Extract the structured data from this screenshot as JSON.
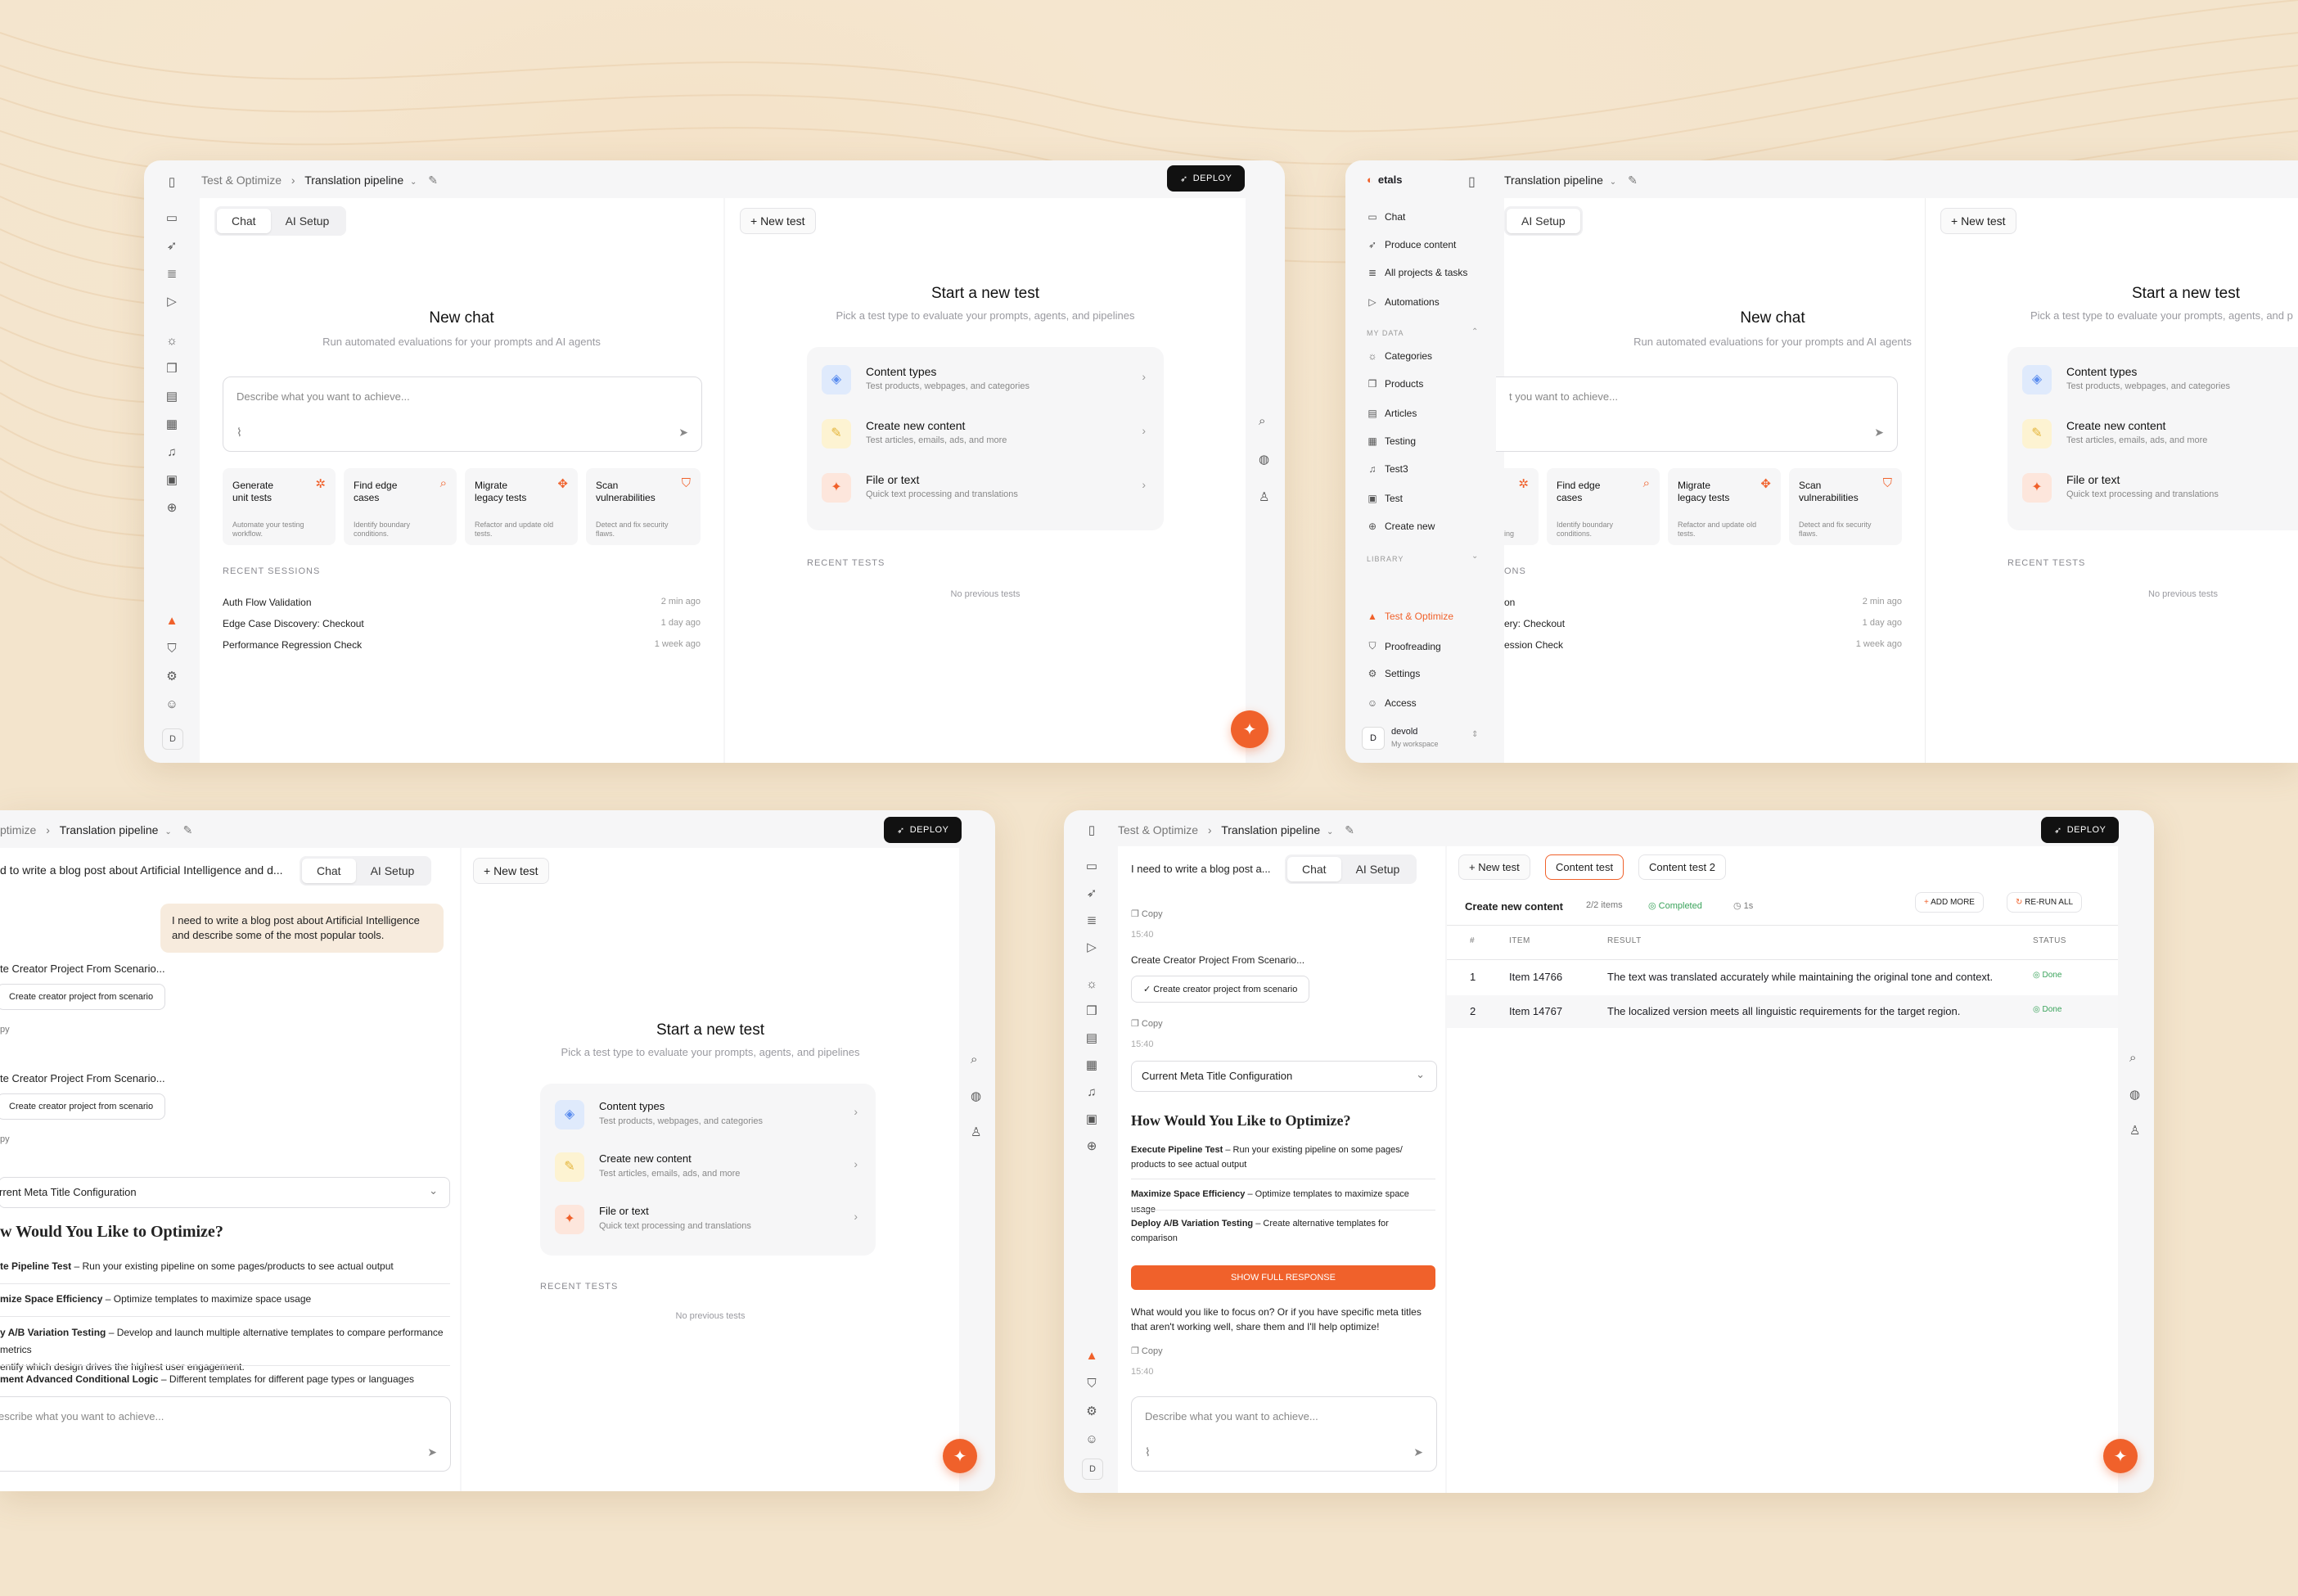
{
  "breadcrumb": {
    "section": "Test & Optimize",
    "page": "Translation pipeline"
  },
  "deploy_label": "DEPLOY",
  "tabs": {
    "chat": "Chat",
    "ai_setup": "AI Setup"
  },
  "new_test_btn": "+ New test",
  "chat": {
    "title": "New chat",
    "subtitle": "Run automated evaluations for your prompts and AI agents",
    "placeholder": "Describe what you want to achieve...",
    "placeholder_cropped": "t you want to achieve...",
    "tiles": [
      {
        "title": "Generate unit tests",
        "desc": "Automate your testing workflow."
      },
      {
        "title": "Find edge cases",
        "desc": "Identify boundary conditions."
      },
      {
        "title": "Migrate legacy tests",
        "desc": "Refactor and update old tests."
      },
      {
        "title": "Scan vulnerabilities",
        "desc": "Detect and fix security flaws."
      }
    ],
    "recent_label": "RECENT SESSIONS",
    "recent_label_cropped": "ONS",
    "sessions": [
      {
        "name": "Auth Flow Validation",
        "time": "2 min ago"
      },
      {
        "name": "Edge Case Discovery: Checkout",
        "time": "1 day ago"
      },
      {
        "name": "Performance Regression Check",
        "time": "1 week ago"
      }
    ],
    "sessions_cropped": [
      "on",
      "ery: Checkout",
      "ession Check"
    ],
    "tile_cropped_1": "ing"
  },
  "tests": {
    "title": "Start a new test",
    "subtitle": "Pick a test type to evaluate your prompts, agents, and pipelines",
    "subtitle_cropped": "Pick a test type to evaluate your prompts, agents, and p",
    "types": [
      {
        "title": "Content types",
        "desc": "Test products, webpages, and categories"
      },
      {
        "title": "Create new content",
        "desc": "Test articles, emails, ads, and more"
      },
      {
        "title": "File or text",
        "desc": "Quick text processing and translations"
      }
    ],
    "recent_label": "RECENT TESTS",
    "empty": "No previous tests"
  },
  "sidebar": {
    "brand": "etals",
    "items_top": [
      "Chat",
      "Produce content",
      "All projects & tasks",
      "Automations"
    ],
    "my_data_label": "MY DATA",
    "my_data": [
      "Categories",
      "Products",
      "Articles",
      "Testing",
      "Test3",
      "Test",
      "Create new"
    ],
    "library_label": "LIBRARY",
    "items_bottom": [
      "Test & Optimize",
      "Proofreading",
      "Settings",
      "Access"
    ],
    "user_initial": "D",
    "user_name": "devold",
    "user_workspace": "My workspace"
  },
  "rail_avatar": "D",
  "conversation": {
    "title": "d to write a blog post about Artificial Intelligence and d...",
    "title_w4": "I need to write a blog post a...",
    "user_msg": "I need to write a blog post about Artificial Intelligence and describe some of the most popular tools.",
    "step_title": "te Creator Project From Scenario...",
    "step_title_full": "Create Creator Project From Scenario...",
    "step_chip": "Create creator project from scenario",
    "copy": "Copy",
    "copy_cropped": "py",
    "timestamp": "15:40",
    "select": "rrent Meta Title Configuration",
    "select_full": "Current Meta Title Configuration",
    "heading": "w Would You Like to Optimize?",
    "heading_full": "How Would You Like to Optimize?",
    "options": [
      {
        "bold": "te Pipeline Test",
        "rest": " – Run your existing pipeline on some pages/products to see actual output"
      },
      {
        "bold": "mize Space Efficiency",
        "rest": " – Optimize templates to maximize space usage"
      },
      {
        "bold": "y A/B Variation Testing",
        "rest": " – Develop and launch multiple alternative templates to compare performance metrics"
      },
      {
        "bold": "ment Advanced Conditional Logic",
        "rest": " – Different templates for different page types or languages"
      }
    ],
    "option3_line2": "entify which design drives the highest user engagement.",
    "options_full": [
      {
        "bold": "Execute Pipeline Test",
        "rest": " – Run your existing pipeline on some pages/ products to see actual output"
      },
      {
        "bold": "Maximize Space Efficiency",
        "rest": " – Optimize templates to maximize space usage"
      },
      {
        "bold": "Deploy A/B Variation Testing",
        "rest": " – Create alternative templates for comparison"
      }
    ],
    "show_full": "SHOW FULL RESPONSE",
    "followup": "What would you like to focus on? Or if you have specific meta titles that aren't working well, share them and I'll help optimize!",
    "input_placeholder": "escribe what you want to achieve..."
  },
  "results": {
    "tabs": [
      "+ New test",
      "Content test",
      "Content test 2"
    ],
    "title": "Create new content",
    "count": "2/2 items",
    "status": "Completed",
    "duration": "1s",
    "add_more": "ADD MORE",
    "rerun": "RE-RUN ALL",
    "columns": [
      "#",
      "ITEM",
      "RESULT",
      "STATUS"
    ],
    "rows": [
      {
        "n": "1",
        "item": "Item 14766",
        "result": "The text was translated accurately while maintaining the original tone and context.",
        "status": "Done"
      },
      {
        "n": "2",
        "item": "Item 14767",
        "result": "The localized version meets all linguistic requirements for the target region.",
        "status": "Done"
      }
    ]
  },
  "breadcrumb_cropped": "ptimize",
  "colors": {
    "accent": "#f0612b",
    "dark": "#111111",
    "bubble": "#f7ebdd"
  }
}
